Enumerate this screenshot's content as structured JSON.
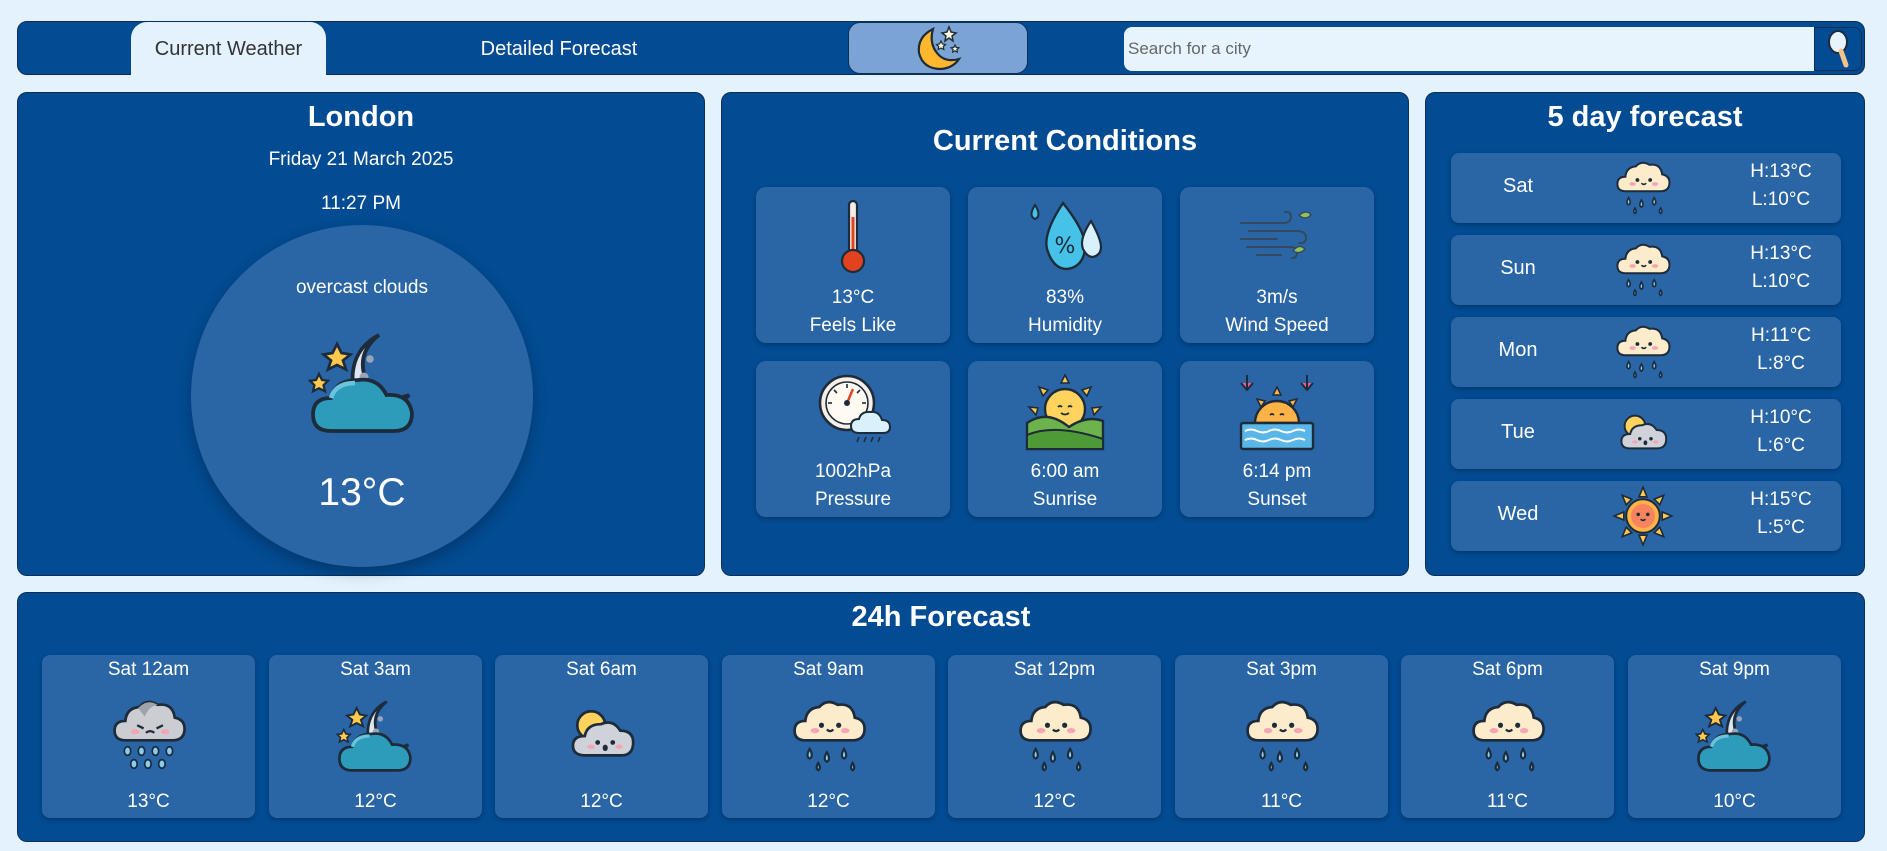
{
  "tabs": {
    "current": "Current Weather",
    "detailed": "Detailed Forecast"
  },
  "search": {
    "placeholder": "Search for a city",
    "icon": "magnifier-icon"
  },
  "theme_toggle": {
    "icon": "moon-stars-icon"
  },
  "current": {
    "city": "London",
    "date": "Friday 21 March 2025",
    "time": "11:27 PM",
    "description": "overcast clouds",
    "temp": "13°C",
    "icon": "night-cloud-icon"
  },
  "conditions": {
    "title": "Current Conditions",
    "tiles": [
      {
        "value": "13°C",
        "label": "Feels Like",
        "icon": "thermometer-icon"
      },
      {
        "value": "83%",
        "label": "Humidity",
        "icon": "humidity-drops-icon"
      },
      {
        "value": "3m/s",
        "label": "Wind Speed",
        "icon": "wind-icon"
      },
      {
        "value": "1002hPa",
        "label": "Pressure",
        "icon": "barometer-icon"
      },
      {
        "value": "6:00 am",
        "label": "Sunrise",
        "icon": "sunrise-icon"
      },
      {
        "value": "6:14 pm",
        "label": "Sunset",
        "icon": "sunset-icon"
      }
    ]
  },
  "five_day": {
    "title": "5 day forecast",
    "days": [
      {
        "day": "Sat",
        "high": "H:13°C",
        "low": "L:10°C",
        "icon": "rain-cloud-icon"
      },
      {
        "day": "Sun",
        "high": "H:13°C",
        "low": "L:10°C",
        "icon": "rain-cloud-icon"
      },
      {
        "day": "Mon",
        "high": "H:11°C",
        "low": "L:8°C",
        "icon": "rain-cloud-icon"
      },
      {
        "day": "Tue",
        "high": "H:10°C",
        "low": "L:6°C",
        "icon": "sun-cloud-icon"
      },
      {
        "day": "Wed",
        "high": "H:15°C",
        "low": "L:5°C",
        "icon": "sun-icon"
      }
    ]
  },
  "hourly": {
    "title": "24h Forecast",
    "hours": [
      {
        "time": "Sat 12am",
        "temp": "13°C",
        "icon": "grey-rain-cloud-icon"
      },
      {
        "time": "Sat 3am",
        "temp": "12°C",
        "icon": "night-cloud-icon"
      },
      {
        "time": "Sat 6am",
        "temp": "12°C",
        "icon": "sun-cloud-icon"
      },
      {
        "time": "Sat 9am",
        "temp": "12°C",
        "icon": "rain-cloud-icon"
      },
      {
        "time": "Sat 12pm",
        "temp": "12°C",
        "icon": "rain-cloud-icon"
      },
      {
        "time": "Sat 3pm",
        "temp": "11°C",
        "icon": "rain-cloud-icon"
      },
      {
        "time": "Sat 6pm",
        "temp": "11°C",
        "icon": "rain-cloud-icon"
      },
      {
        "time": "Sat 9pm",
        "temp": "10°C",
        "icon": "night-cloud-icon"
      }
    ]
  }
}
